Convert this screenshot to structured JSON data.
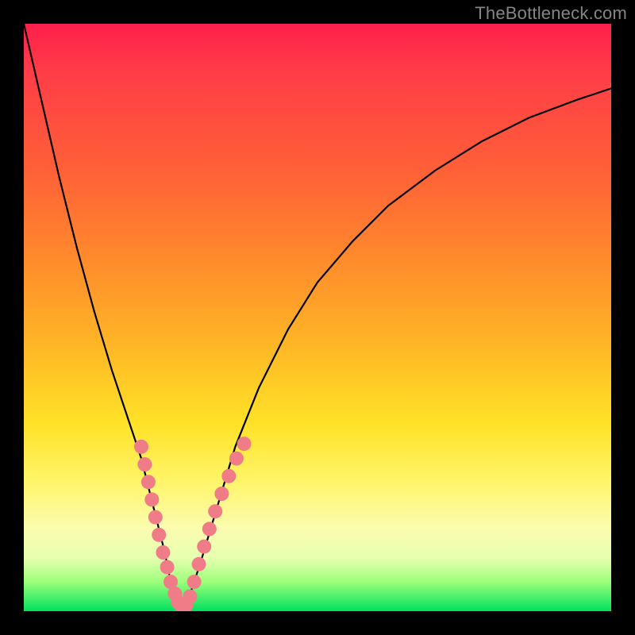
{
  "watermark": "TheBottleneck.com",
  "chart_data": {
    "type": "line",
    "title": "",
    "xlabel": "",
    "ylabel": "",
    "xlim": [
      0,
      100
    ],
    "ylim": [
      0,
      100
    ],
    "series": [
      {
        "name": "bottleneck-curve",
        "x": [
          0,
          3,
          6,
          9,
          12,
          15,
          18,
          20,
          22,
          24,
          25,
          26,
          27,
          28,
          30,
          33,
          36,
          40,
          45,
          50,
          56,
          62,
          70,
          78,
          86,
          94,
          100
        ],
        "y": [
          100,
          87,
          74,
          62,
          51,
          41,
          32,
          26,
          18,
          10,
          5,
          2,
          0,
          2,
          8,
          18,
          28,
          38,
          48,
          56,
          63,
          69,
          75,
          80,
          84,
          87,
          89
        ]
      }
    ],
    "markers": {
      "name": "highlight-dots",
      "color": "#f07c88",
      "points": [
        {
          "x": 20.0,
          "y": 28
        },
        {
          "x": 20.6,
          "y": 25
        },
        {
          "x": 21.2,
          "y": 22
        },
        {
          "x": 21.8,
          "y": 19
        },
        {
          "x": 22.4,
          "y": 16
        },
        {
          "x": 23.0,
          "y": 13
        },
        {
          "x": 23.7,
          "y": 10
        },
        {
          "x": 24.4,
          "y": 7.5
        },
        {
          "x": 25.0,
          "y": 5
        },
        {
          "x": 25.7,
          "y": 3
        },
        {
          "x": 26.3,
          "y": 1.5
        },
        {
          "x": 27.0,
          "y": 0.5
        },
        {
          "x": 27.6,
          "y": 1
        },
        {
          "x": 28.3,
          "y": 2.5
        },
        {
          "x": 29.0,
          "y": 5
        },
        {
          "x": 29.8,
          "y": 8
        },
        {
          "x": 30.7,
          "y": 11
        },
        {
          "x": 31.6,
          "y": 14
        },
        {
          "x": 32.6,
          "y": 17
        },
        {
          "x": 33.7,
          "y": 20
        },
        {
          "x": 34.9,
          "y": 23
        },
        {
          "x": 36.2,
          "y": 26
        },
        {
          "x": 37.5,
          "y": 28.5
        }
      ]
    },
    "background_gradient": {
      "stops": [
        {
          "pos": 0,
          "color": "#ff1f4b"
        },
        {
          "pos": 25,
          "color": "#ff6037"
        },
        {
          "pos": 55,
          "color": "#ffb726"
        },
        {
          "pos": 78,
          "color": "#fff56a"
        },
        {
          "pos": 91,
          "color": "#e6ffb0"
        },
        {
          "pos": 100,
          "color": "#00e060"
        }
      ]
    }
  }
}
